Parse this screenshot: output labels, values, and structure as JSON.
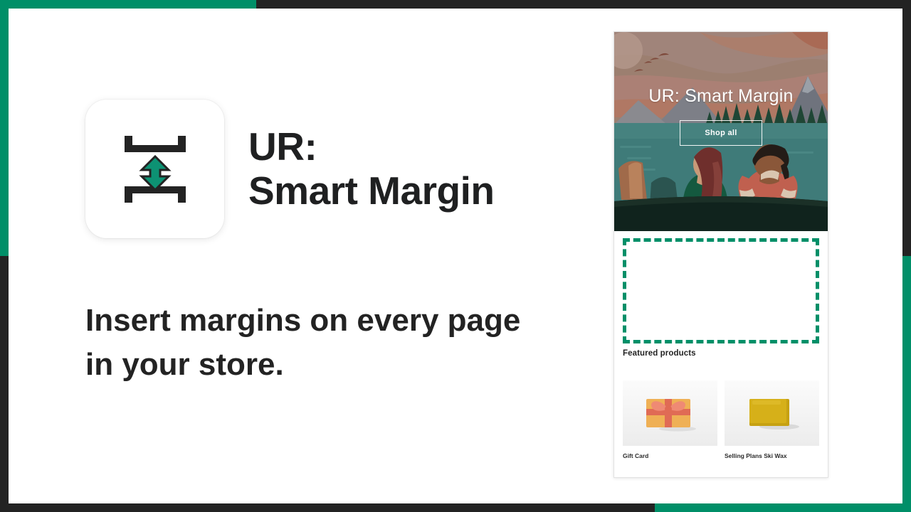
{
  "theme": {
    "accent_green": "#008f68",
    "dark": "#232323",
    "text": "#1f2021",
    "panel_bg": "#ffffff"
  },
  "app": {
    "icon_name": "smart-margin-icon",
    "title": "UR:\nSmart Margin",
    "title_line1": "UR:",
    "title_line2": "Smart Margin",
    "tagline": "Insert margins on every page\nin your store."
  },
  "store_preview": {
    "hero": {
      "title": "UR: Smart Margin",
      "button_label": "Shop all",
      "illustration_name": "couple-in-canoe-on-lake-illustration"
    },
    "margin_zone": {
      "label": "",
      "border_style": "dashed",
      "border_color": "#008f68"
    },
    "featured": {
      "section_title": "Featured products",
      "products": [
        {
          "name": "Gift Card",
          "image_name": "gift-box-image"
        },
        {
          "name": "Selling Plans Ski Wax",
          "image_name": "ski-wax-block-image"
        }
      ]
    }
  }
}
